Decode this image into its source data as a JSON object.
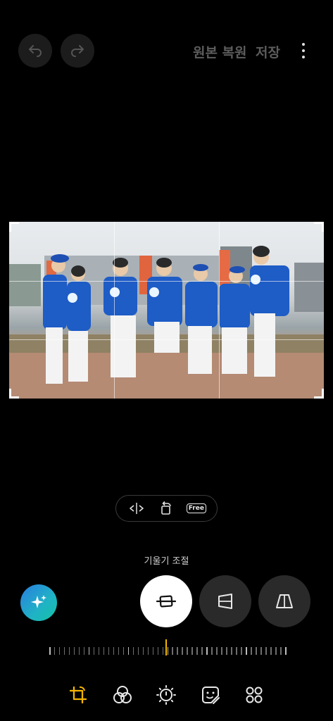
{
  "header": {
    "undo_icon": "undo-arrow",
    "redo_icon": "redo-arrow",
    "revert_label": "원본 복원",
    "save_label": "저장",
    "more_icon": "more-vertical"
  },
  "crop_tools": {
    "flip_icon": "flip-horizontal",
    "rotate_icon": "rotate",
    "free_label": "Free"
  },
  "tilt": {
    "label": "기울기 조절",
    "value": 0,
    "modes": [
      "straighten",
      "vertical-perspective",
      "horizontal-perspective"
    ],
    "selected_mode": "straighten"
  },
  "ai_button_icon": "sparkles",
  "bottom_nav": {
    "items": [
      "crop-rotate",
      "filters",
      "brightness",
      "stickers",
      "more-tools"
    ],
    "active": "crop-rotate",
    "active_color": "#f4b400"
  },
  "colors": {
    "background": "#000000",
    "accent": "#f4b400",
    "uniform_blue": "#1f5fc8"
  }
}
